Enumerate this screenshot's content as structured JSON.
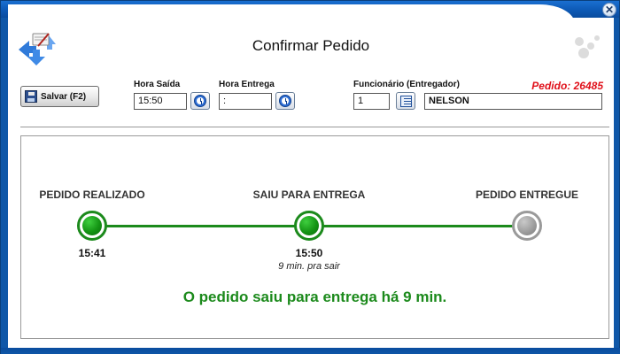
{
  "window": {
    "title": "Confirmar Pedido",
    "close_icon": "close-icon"
  },
  "toolbar": {
    "save_label": "Salvar (F2)",
    "save_icon": "floppy-disk-icon"
  },
  "hora_saida": {
    "label": "Hora Saída",
    "value": "15:50"
  },
  "hora_entrega": {
    "label": "Hora Entrega",
    "value": " :"
  },
  "funcionario": {
    "label": "Funcionário (Entregador)",
    "code": "1",
    "name": "NELSON"
  },
  "pedido": {
    "text": "Pedido: 26485"
  },
  "steps": [
    {
      "label": "PEDIDO REALIZADO",
      "time": "15:41",
      "sub": "",
      "status": "done"
    },
    {
      "label": "SAIU PARA ENTREGA",
      "time": "15:50",
      "sub": "9 min. pra sair",
      "status": "done"
    },
    {
      "label": "PEDIDO ENTREGUE",
      "time": "",
      "sub": "",
      "status": "pending"
    }
  ],
  "status_message": "O pedido saiu para entrega há 9 min.",
  "colors": {
    "accent_green": "#1c8a1c",
    "pedido_red": "#e0101a",
    "frame_blue": "#0f57a8"
  }
}
